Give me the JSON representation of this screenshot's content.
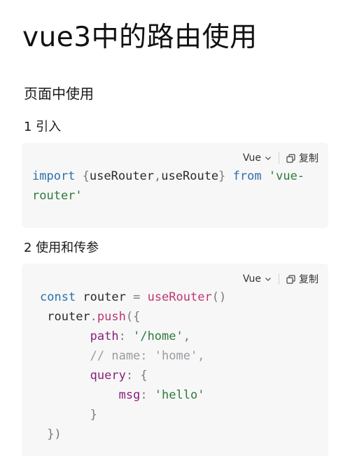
{
  "page": {
    "title": "vue3中的路由使用"
  },
  "section": {
    "heading": "页面中使用"
  },
  "steps": [
    {
      "label": "1 引入"
    },
    {
      "label": "2 使用和传参"
    }
  ],
  "blocks": [
    {
      "language": "Vue",
      "copy_label": "复制",
      "lines": {
        "l1": {
          "kw": "import",
          "p1": " {",
          "a": "useRouter",
          "comma": ",",
          "b": "useRoute",
          "p2": "} ",
          "from": "from",
          "sp": " ",
          "str1": "'vue-"
        },
        "l2": {
          "str2": "router'"
        }
      }
    },
    {
      "language": "Vue",
      "copy_label": "复制",
      "lines": {
        "l1": {
          "kw": "const",
          "sp": " router ",
          "eq": "=",
          "sp2": " ",
          "fn": "useRouter",
          "pn": "()"
        },
        "l2": {
          "ind": " ",
          "obj": "router",
          "dot": ".",
          "fn": "push",
          "pn": "({"
        },
        "l3": {
          "ind": "       ",
          "prop": "path",
          "col": ": ",
          "str": "'/home'",
          "comma": ","
        },
        "l4": {
          "ind": "       ",
          "cm": "// name: 'home',"
        },
        "l5": {
          "ind": "       ",
          "prop": "query",
          "col": ": ",
          "pn": "{"
        },
        "l6": {
          "ind": "           ",
          "prop": "msg",
          "col": ": ",
          "str": "'hello'"
        },
        "l7": {
          "ind": "       ",
          "pn": "}"
        },
        "l8": {
          "ind": " ",
          "pn": "})"
        }
      }
    }
  ],
  "colors": {
    "keyword": "#2e6ea8",
    "function": "#c0356f",
    "string": "#2c7a3b",
    "property": "#8a1f7a",
    "comment": "#9a9aa0",
    "code_background": "#f7f7f8"
  },
  "icons": {
    "language_dropdown": "chevron-down-icon",
    "copy": "copy-icon"
  }
}
